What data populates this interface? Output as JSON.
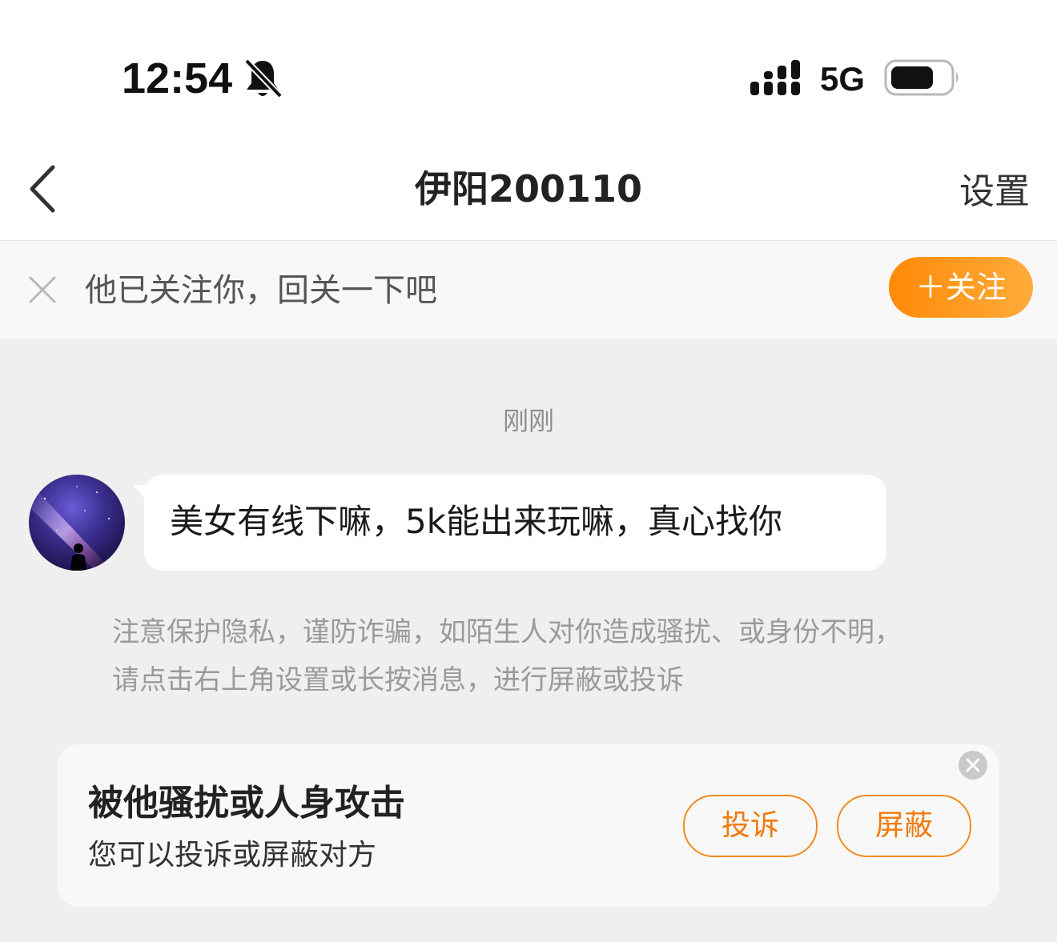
{
  "status_bar": {
    "time": "12:54",
    "network": "5G",
    "icons": [
      "bell-slash-icon",
      "signal-icon",
      "battery-icon"
    ]
  },
  "nav": {
    "back_icon": "chevron-left-icon",
    "title": "伊阳200110",
    "settings_label": "设置"
  },
  "follow_banner": {
    "dismiss_icon": "close-icon",
    "prompt": "他已关注你，回关一下吧",
    "follow_label": "＋关注",
    "accent_color": "#ff8a08"
  },
  "chat": {
    "timestamp": "刚刚",
    "messages": [
      {
        "sender": "other",
        "text": "美女有线下嘛，5k能出来玩嘛，真心找你"
      }
    ],
    "safety_notice": [
      "注意保护隐私，谨防诈骗，如陌生人对你造成骚扰、或身份不明，",
      "请点击右上角设置或长按消息，进行屏蔽或投诉"
    ]
  },
  "report_card": {
    "title": "被他骚扰或人身攻击",
    "subtitle": "您可以投诉或屏蔽对方",
    "report_label": "投诉",
    "block_label": "屏蔽",
    "close_icon": "close-circle-icon",
    "accent_color": "#f18a1e"
  }
}
